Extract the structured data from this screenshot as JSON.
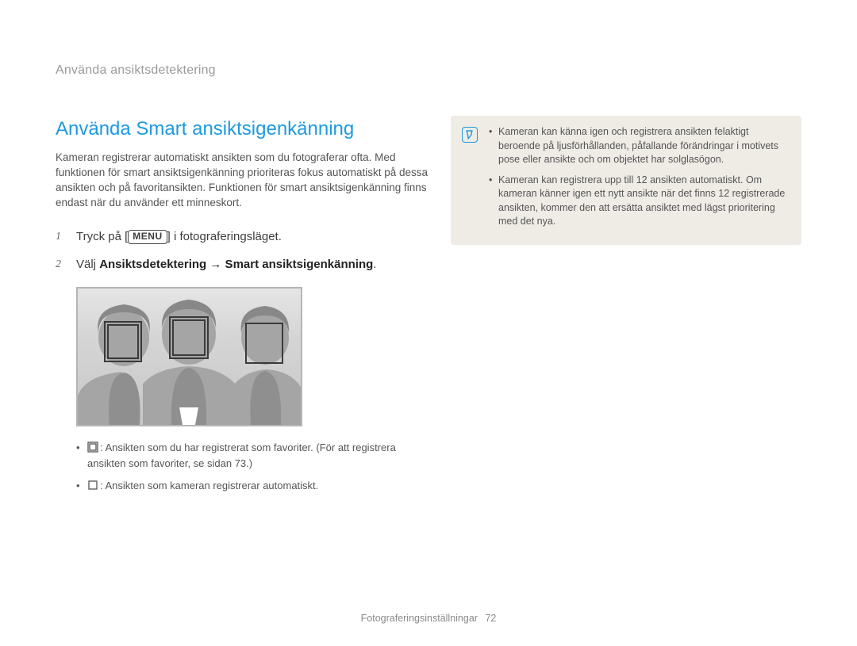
{
  "breadcrumb": "Använda ansiktsdetektering",
  "section_title": "Använda Smart ansiktsigenkänning",
  "intro": "Kameran registrerar automatiskt ansikten som du fotograferar ofta. Med funktionen för smart ansiktsigenkänning prioriteras fokus automatiskt på dessa ansikten och på favoritansikten. Funktionen för smart ansiktsigenkänning finns endast när du använder ett minneskort.",
  "steps": {
    "step1_pre": "Tryck på [",
    "step1_menu": "MENU",
    "step1_post": "] i fotograferingsläget.",
    "step2_pre": "Välj ",
    "step2_bold": "Ansiktsdetektering → Smart ansiktsigenkänning",
    "step2_post": "."
  },
  "legend": {
    "item1_text": ": Ansikten som du har registrerat som favoriter. (För att registrera ansikten som favoriter, se sidan 73.)",
    "item2_text": ": Ansikten som kameran registrerar automatiskt."
  },
  "notes": {
    "n1": "Kameran kan känna igen och registrera ansikten felaktigt beroende på ljusförhållanden, påfallande förändringar i motivets pose eller ansikte och om objektet har solglasögon.",
    "n2": "Kameran kan registrera upp till 12 ansikten automatiskt. Om kameran känner igen ett nytt ansikte när det finns 12 registrerade ansikten, kommer den att ersätta ansiktet med lägst prioritering med det nya."
  },
  "footer": {
    "label": "Fotograferingsinställningar",
    "page": "72"
  }
}
